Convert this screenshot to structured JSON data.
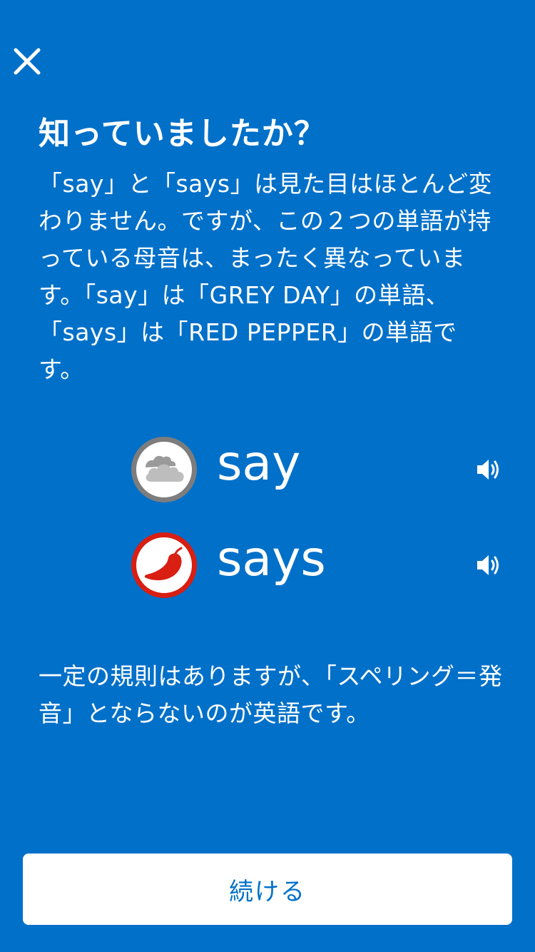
{
  "header": {
    "close_icon": "close-icon"
  },
  "title": "知っていましたか？",
  "body": "「say」と「says」は見た目はほとんど変わりません。ですが、この２つの単語が持っている母音は、まったく異なっています。「say」は「GREY DAY」の単語、「says」は「RED PEPPER」の単語です。",
  "words": [
    {
      "text": "say",
      "icon": "cloud-icon",
      "icon_border_color": "#7d7d7d",
      "audio_icon": "speaker-icon"
    },
    {
      "text": "says",
      "icon": "chili-pepper-icon",
      "icon_border_color": "#d91e12",
      "audio_icon": "speaker-icon"
    }
  ],
  "note": "一定の規則はありますが、「スペリング＝発音」とならないのが英語です。",
  "footer": {
    "continue_label": "続ける"
  },
  "colors": {
    "background": "#0070c9",
    "button_bg": "#ffffff",
    "button_text": "#0070c9"
  }
}
